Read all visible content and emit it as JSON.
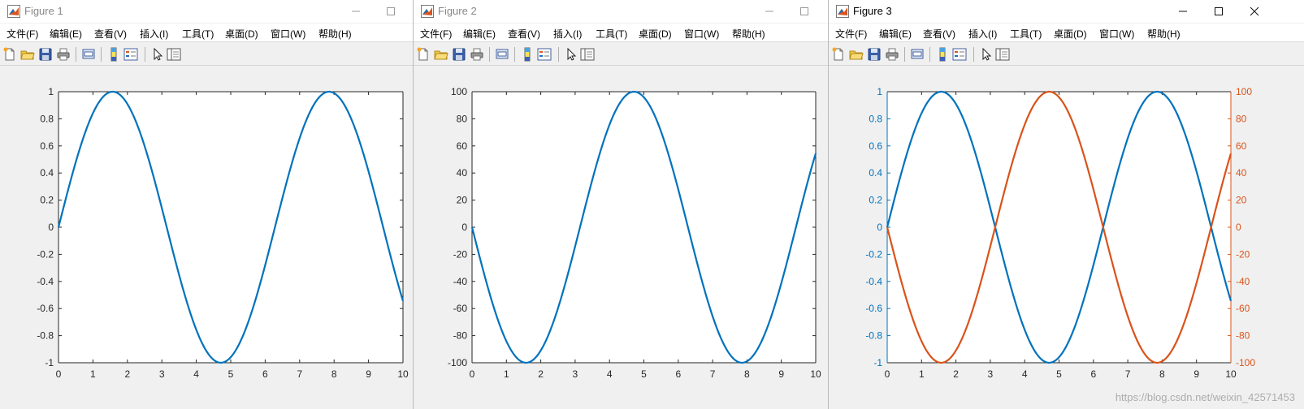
{
  "menu_labels": [
    "文件(F)",
    "编辑(E)",
    "查看(V)",
    "插入(I)",
    "工具(T)",
    "桌面(D)",
    "窗口(W)",
    "帮助(H)"
  ],
  "windows": [
    {
      "title": "Figure 1",
      "show_close": false
    },
    {
      "title": "Figure 2",
      "show_close": false
    },
    {
      "title": "Figure 3",
      "show_close": true
    }
  ],
  "colors": {
    "series_blue": "#0072BD",
    "series_orange": "#D95319",
    "axis": "#262626",
    "plot_bg": "#ffffff",
    "figure_bg": "#f0f0f0"
  },
  "toolbar_icons": [
    "new-figure-icon",
    "open-file-icon",
    "save-icon",
    "print-icon",
    "print-preview-icon",
    "insert-colorbar-icon",
    "insert-legend-icon",
    "edit-plot-cursor-icon",
    "property-inspector-icon"
  ],
  "watermark": "https://blog.csdn.net/weixin_42571453",
  "chart_data": [
    {
      "type": "line",
      "x_range": [
        0,
        10
      ],
      "xticks": [
        0,
        1,
        2,
        3,
        4,
        5,
        6,
        7,
        8,
        9,
        10
      ],
      "ylim": [
        -1,
        1
      ],
      "yticks": [
        -1,
        -0.8,
        -0.6,
        -0.4,
        -0.2,
        0,
        0.2,
        0.4,
        0.6,
        0.8,
        1
      ],
      "grid": false,
      "series": [
        {
          "function": "sin(x)",
          "color": "#0072BD",
          "axis": "left"
        }
      ]
    },
    {
      "type": "line",
      "x_range": [
        0,
        10
      ],
      "xticks": [
        0,
        1,
        2,
        3,
        4,
        5,
        6,
        7,
        8,
        9,
        10
      ],
      "ylim": [
        -100,
        100
      ],
      "yticks": [
        -100,
        -80,
        -60,
        -40,
        -20,
        0,
        20,
        40,
        60,
        80,
        100
      ],
      "grid": false,
      "series": [
        {
          "function": "-100*cos(x/2)... shown as 100*sin(x-π)",
          "color": "#0072BD",
          "axis": "left"
        }
      ]
    },
    {
      "type": "line",
      "x_range": [
        0,
        10
      ],
      "xticks": [
        0,
        1,
        2,
        3,
        4,
        5,
        6,
        7,
        8,
        9,
        10
      ],
      "ylim": [
        -1,
        1
      ],
      "yticks": [
        -1,
        -0.8,
        -0.6,
        -0.4,
        -0.2,
        0,
        0.2,
        0.4,
        0.6,
        0.8,
        1
      ],
      "y2lim": [
        -100,
        100
      ],
      "y2ticks": [
        -100,
        -80,
        -60,
        -40,
        -20,
        0,
        20,
        40,
        60,
        80,
        100
      ],
      "grid": false,
      "series": [
        {
          "function": "sin(x)",
          "color": "#0072BD",
          "axis": "left"
        },
        {
          "function": "100*sin(x-π)",
          "color": "#D95319",
          "axis": "right"
        }
      ]
    }
  ]
}
